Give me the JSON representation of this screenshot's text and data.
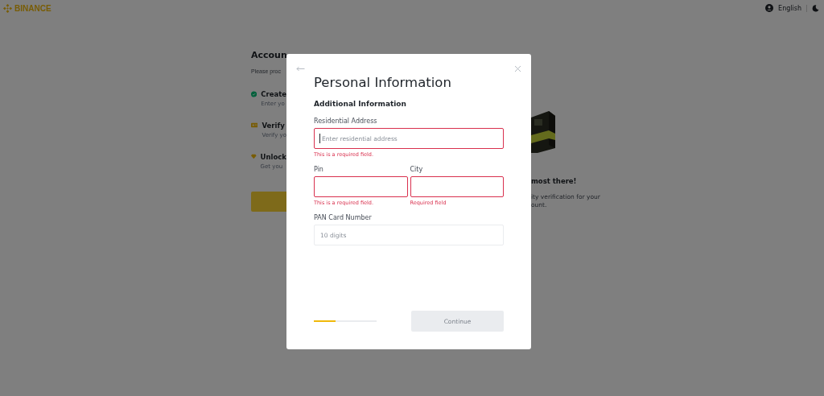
{
  "header": {
    "logo": "BINANCE",
    "language": "English"
  },
  "background": {
    "title": "Accoun",
    "subtitle": "Please proc",
    "steps": [
      {
        "kind": "done",
        "title": "Create",
        "text": "Enter yo"
      },
      {
        "kind": "card",
        "title": "Verify",
        "text": "Verify yo"
      },
      {
        "kind": "gem",
        "title": "Unlock",
        "text": "Get you"
      }
    ],
    "promo": {
      "title": "most there!",
      "lines": [
        "ity verification for your",
        "ount."
      ]
    }
  },
  "modal": {
    "title": "Personal Information",
    "section": "Additional Information",
    "rows": [
      [
        {
          "label": "Residential Address",
          "placeholder": "Enter residential address",
          "focused": true,
          "invalid": true,
          "error": "This is a required field."
        }
      ],
      [
        {
          "label": "Pin",
          "focused": false,
          "invalid": true,
          "error": "This is a required field."
        },
        {
          "label": "City",
          "focused": false,
          "invalid": true,
          "error": "Required field"
        }
      ],
      [
        {
          "label": "PAN Card Number",
          "placeholder": "10 digits",
          "focused": false,
          "invalid": false
        }
      ]
    ],
    "progress": {
      "level": 0.34
    },
    "continue_button": {
      "label": "Continue",
      "disabled": true
    }
  }
}
